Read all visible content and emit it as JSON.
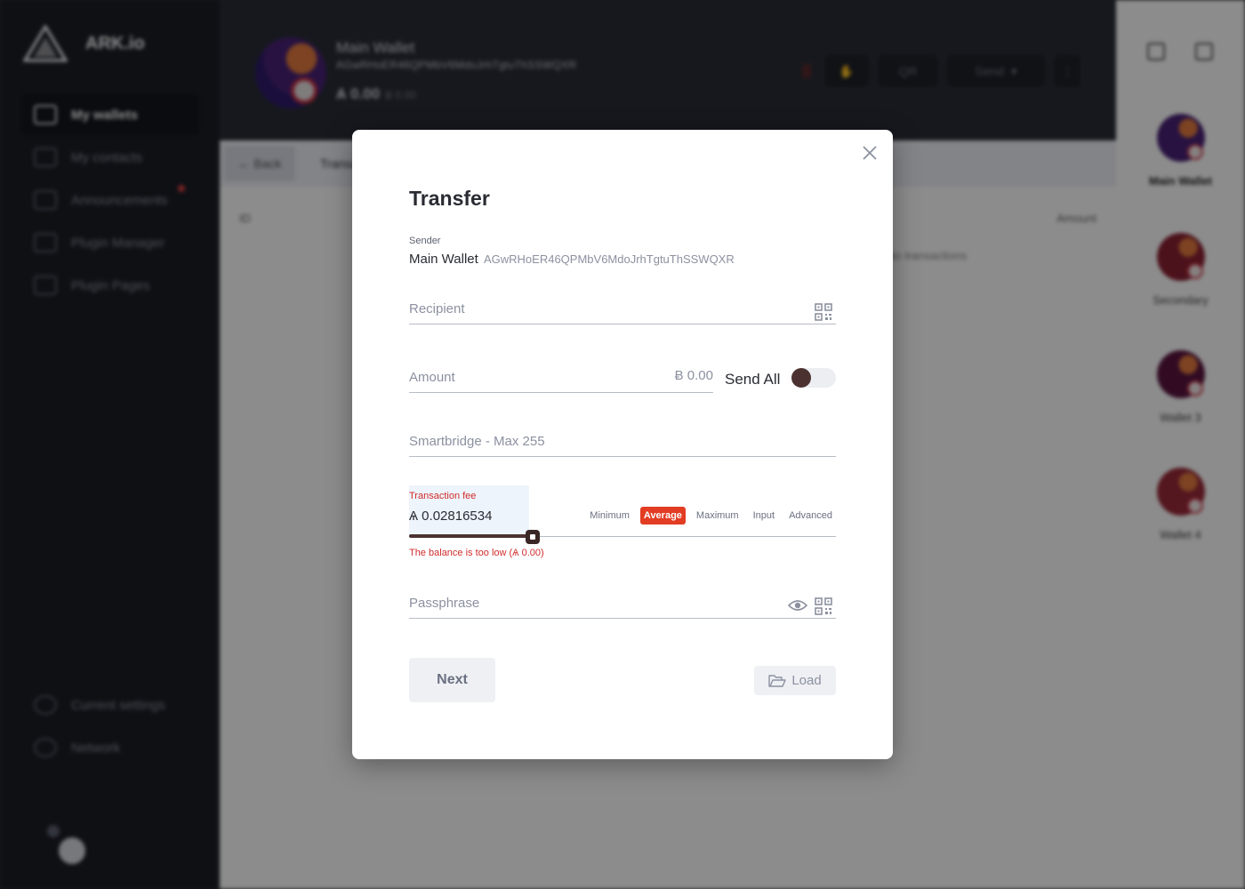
{
  "app": {
    "logo_text": "ARK.io",
    "nav": [
      {
        "label": "My wallets"
      },
      {
        "label": "My contacts"
      },
      {
        "label": "Announcements"
      },
      {
        "label": "Plugin Manager"
      },
      {
        "label": "Plugin Pages"
      },
      {
        "label": "Current settings"
      },
      {
        "label": "Network"
      }
    ],
    "wallet": {
      "name": "Main Wallet",
      "address": "AGwRHoER46QPMbV6MdoJrhTgtuThSSWQXR",
      "balance": "Ѧ 0.00",
      "balance_fiat": "Ƀ 0.00"
    },
    "top_actions": {
      "qr": "QR",
      "send": "Send"
    },
    "tabs": {
      "back": "← Back",
      "transactions": "Transactions"
    },
    "table": {
      "col_id": "ID",
      "col_amount": "Amount",
      "empty": "No transactions"
    },
    "right_wallets": [
      {
        "name": "Main Wallet",
        "color": "#4a2277"
      },
      {
        "name": "Secondary",
        "color": "#8b2233"
      },
      {
        "name": "Wallet 3",
        "color": "#5b1540"
      },
      {
        "name": "Wallet 4",
        "color": "#9a2a3a"
      }
    ]
  },
  "modal": {
    "title": "Transfer",
    "sender": {
      "label": "Sender",
      "wallet_name": "Main Wallet",
      "address": "AGwRHoER46QPMbV6MdoJrhTgtuThSSWQXR"
    },
    "recipient": {
      "placeholder": "Recipient"
    },
    "amount": {
      "placeholder": "Amount",
      "value": "Ƀ 0.00"
    },
    "send_all": {
      "label": "Send All",
      "enabled": false
    },
    "smartbridge": {
      "placeholder": "Smartbridge - Max 255"
    },
    "fee": {
      "label": "Transaction fee",
      "value": "Ѧ 0.02816534",
      "options": [
        "Minimum",
        "Average",
        "Maximum",
        "Input",
        "Advanced"
      ],
      "selected": "Average",
      "slider_fraction": 0.29,
      "error": "The balance is too low (Ѧ 0.00)"
    },
    "passphrase": {
      "placeholder": "Passphrase"
    },
    "buttons": {
      "next": "Next",
      "load": "Load"
    }
  },
  "colors": {
    "accent": "#e23c23",
    "error": "#d12c2c",
    "slider": "#4b3231",
    "sidebar_bg": "#1c1e26"
  }
}
